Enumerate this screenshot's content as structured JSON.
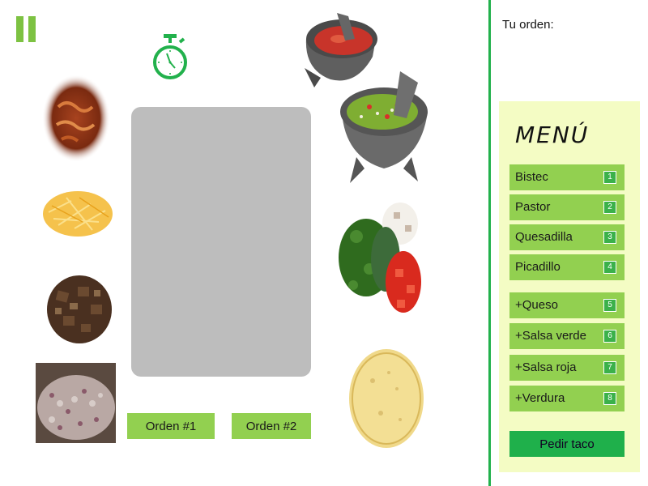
{
  "game": {
    "order_buttons": [
      "Orden #1",
      "Orden #2"
    ],
    "your_order_label": "Tu orden:",
    "your_order_items": []
  },
  "menu": {
    "title": "MENÚ",
    "items": [
      {
        "label": "Bistec",
        "key": "1"
      },
      {
        "label": "Pastor",
        "key": "2"
      },
      {
        "label": "Quesadilla",
        "key": "3"
      },
      {
        "label": "Picadillo",
        "key": "4"
      },
      {
        "label": "+Queso",
        "key": "5"
      },
      {
        "label": "+Salsa verde",
        "key": "6"
      },
      {
        "label": "+Salsa roja",
        "key": "7"
      },
      {
        "label": "+Verdura",
        "key": "8"
      }
    ],
    "submit_label": "Pedir taco"
  },
  "ingredients": [
    "pastor-meat",
    "shredded-cheese",
    "bistec-meat",
    "picadillo",
    "salsa-roja-molcajete",
    "guacamole-molcajete",
    "chopped-vegetables",
    "tortilla"
  ],
  "colors": {
    "accent": "#92d050",
    "dark_green": "#22b14c",
    "panel": "#f4fcc4"
  }
}
